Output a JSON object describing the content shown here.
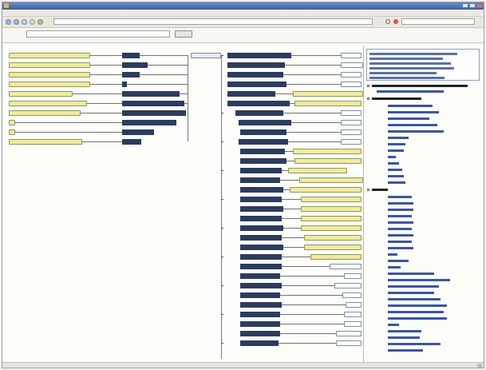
{
  "window": {
    "title": ""
  },
  "menubar": {
    "items": [
      "",
      "",
      "",
      "",
      "",
      "",
      "",
      "",
      ""
    ]
  },
  "toolbar": {
    "url_value": "",
    "search_value": ""
  },
  "address_row": {
    "label": "",
    "value": "",
    "button_label": ""
  },
  "graph": {
    "resource_labels": [],
    "literal_labels": []
  },
  "sidebar": {
    "header_items": [],
    "sections": []
  },
  "statusbar": {
    "text": ""
  }
}
